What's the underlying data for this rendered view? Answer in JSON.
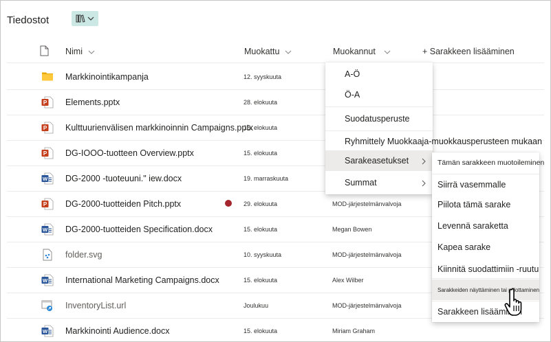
{
  "page": {
    "title": "Tiedostot"
  },
  "columns": {
    "name": "Nimi",
    "modified": "Muokattu",
    "modified_by": "Muokannut",
    "add_column": "+ Sarakkeen lisääminen"
  },
  "rows": [
    {
      "name": "Markkinointikampanja",
      "modified": "12. syyskuuta",
      "modified_by": "",
      "icon": "folder-icon"
    },
    {
      "name": "Elements.pptx",
      "modified": "28. elokuuta",
      "modified_by": "",
      "icon": "powerpoint-icon"
    },
    {
      "name": "Kulttuurienvälisen markkinoinnin Campaigns.pptx",
      "modified": "15. elokuuta",
      "modified_by": "",
      "icon": "powerpoint-icon"
    },
    {
      "name": "DG-IOOO-tuotteen Overview.pptx",
      "modified": "15. elokuuta",
      "modified_by": "",
      "icon": "powerpoint-icon"
    },
    {
      "name": "DG-2000 -tuoteuuni.\" iew.docx",
      "modified": "19. marraskuuta",
      "modified_by": "",
      "icon": "word-icon"
    },
    {
      "name": "DG-2000-tuotteiden Pitch.pptx",
      "modified": "29. elokuuta",
      "modified_by": "MOD-järjestelmänvalvoja",
      "icon": "powerpoint-icon",
      "badge": true
    },
    {
      "name": "DG-2000-tuotteiden Specification.docx",
      "modified": "15. elokuuta",
      "modified_by": "Megan Bowen",
      "icon": "word-icon"
    },
    {
      "name": "folder.svg",
      "modified": "10. syyskuuta",
      "modified_by": "MOD-järjestelmänvalvoja",
      "icon": "svg-file-icon"
    },
    {
      "name": "International Marketing Campaigns.docx",
      "modified": "15. elokuuta",
      "modified_by": "Alex Wilber",
      "icon": "word-icon"
    },
    {
      "name": "InventoryList.url",
      "modified": "Joulukuu",
      "modified_by": "MOD-järjestelmänvalvoja",
      "icon": "url-file-icon"
    },
    {
      "name": "Markkinointi Audience.docx",
      "modified": "15. elokuuta",
      "modified_by": "Miriam Graham",
      "icon": "word-icon"
    }
  ],
  "column_menu": {
    "items": [
      "A-Ö",
      "Ö-A",
      "Suodatusperuste",
      "Ryhmittely Muokkaaja-muokkausperusteen mukaan",
      "Sarakeasetukset",
      "Summat"
    ]
  },
  "submenu": {
    "items": [
      "Tämän sarakkeen muotoileminen",
      "Siirrä vasemmalle",
      "Piilota tämä sarake",
      "Levennä saraketta",
      "Kapea sarake",
      "Kiinnitä suodattimiin -ruutu",
      "Sarakkeiden näyttäminen tai piilottaminen",
      "Sarakkeen lisääminen"
    ]
  },
  "colors": {
    "accent": "#cce8e4",
    "powerpoint": "#c43e1c",
    "word": "#2b579a",
    "folder": "#ffb900"
  }
}
